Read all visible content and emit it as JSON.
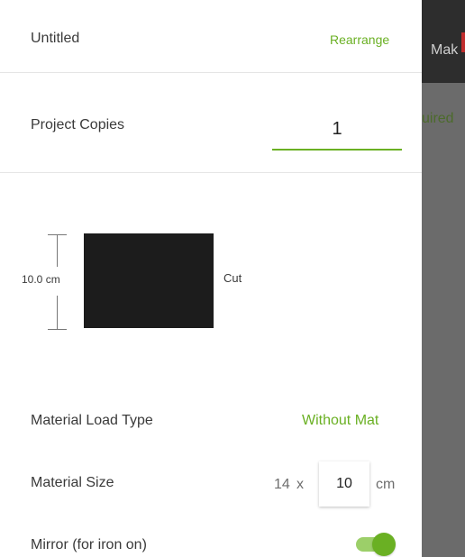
{
  "header": {
    "title": "Untitled",
    "rearrange_label": "Rearrange"
  },
  "copies": {
    "label": "Project Copies",
    "value": "1"
  },
  "preview": {
    "height_label": "10.0 cm",
    "operation_label": "Cut",
    "shape_color": "#1c1c1c"
  },
  "settings": {
    "load_type_label": "Material Load Type",
    "load_type_value": "Without Mat",
    "material_size_label": "Material Size",
    "material_width": "14",
    "material_x": "x",
    "material_height": "10",
    "material_unit": "cm",
    "mirror_label": "Mirror (for iron on)",
    "mirror_on": true
  },
  "background": {
    "tab_label": "Mak",
    "status_text": "uired"
  },
  "colors": {
    "accent": "#6ab023",
    "backdrop": "#6b6b6b",
    "top_bar": "#2d2d2d"
  }
}
